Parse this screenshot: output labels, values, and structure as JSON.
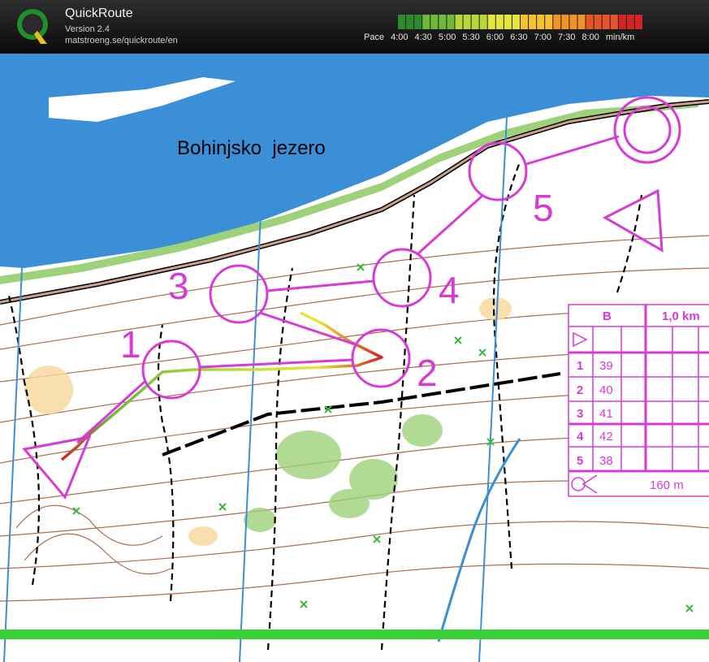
{
  "header": {
    "app_title": "QuickRoute",
    "version": "Version 2.4",
    "url": "matstroeng.se/quickroute/en",
    "logo_letter": "Q"
  },
  "pace_legend": {
    "prefix": "Pace",
    "ticks": [
      "4:00",
      "4:30",
      "5:00",
      "5:30",
      "6:00",
      "6:30",
      "7:00",
      "7:30",
      "8:00"
    ],
    "unit": "min/km",
    "colors": [
      "#2d8a2d",
      "#6fb83a",
      "#b7d83c",
      "#e6e63a",
      "#f2c231",
      "#f0932b",
      "#e8542a",
      "#d42525"
    ]
  },
  "map": {
    "lake_label": "Bohinjsko  jezero",
    "lake_color": "#3b8fd6",
    "course_color": "#d63bd6",
    "controls": [
      {
        "number": "1"
      },
      {
        "number": "2"
      },
      {
        "number": "3"
      },
      {
        "number": "4"
      },
      {
        "number": "5"
      }
    ]
  },
  "control_card": {
    "class": "B",
    "length": "1,0 km",
    "rows": [
      {
        "num": "1",
        "code": "39"
      },
      {
        "num": "2",
        "code": "40"
      },
      {
        "num": "3",
        "code": "41"
      },
      {
        "num": "4",
        "code": "42"
      },
      {
        "num": "5",
        "code": "38"
      }
    ],
    "finish_distance": "160 m"
  }
}
